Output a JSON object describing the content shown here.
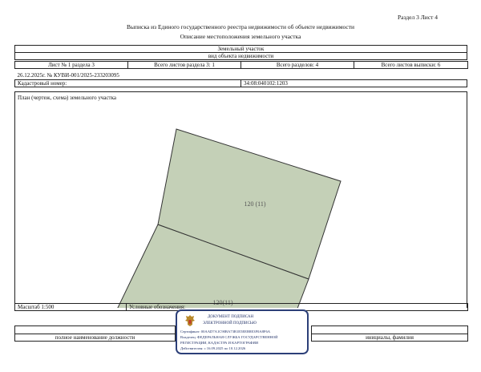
{
  "header": {
    "section_sheet": "Раздел 3   Лист 4",
    "title": "Выписка из Единого государственного реестра недвижимости об объекте недвижимости",
    "subtitle": "Описание местоположения земельного участка"
  },
  "object": {
    "name": "Земельный участок",
    "kind": "вид объекта недвижимости"
  },
  "sheet_info": {
    "sheet": "Лист № 1 раздела 3",
    "total_sheets_section": "Всего листов раздела 3: 1",
    "total_sections": "Всего разделов: 4",
    "total_sheets_extract": "Всего листов выписки: 6"
  },
  "reference": "26.12.2025г. № КУВИ-001/2025-233203095",
  "cadastral": {
    "label": "Кадастровый номер:",
    "value": "34:08:040102:1203"
  },
  "plan": {
    "label": "План (чертеж, схема) земельного участка",
    "parcel_upper": "120 (11)",
    "parcel_lower": "120(11)",
    "parcel_fill": "#c4d0b7",
    "border_color": "#333333"
  },
  "footer": {
    "scale": "Масштаб 1:500",
    "legend_label": "Условные обозначения:",
    "position_label": "полное наименование должности",
    "signature_label": "инициалы, фамилия"
  },
  "stamp": {
    "line1": "ДОКУМЕНТ ПОДПИСАН",
    "line2": "ЭЛЕКТРОННОЙ ПОДПИСЬЮ",
    "line3": "Сертификат: 00AAD7A1C90BA73B1E5EEB8E3F0A8F6A",
    "line4": "Владелец: ФЕДЕРАЛЬНАЯ СЛУЖБА ГОСУДАРСТВЕННОЙ",
    "line5": "РЕГИСТРАЦИИ, КАДАСТРА И КАРТОГРАФИИ",
    "line6": "Действителен: с 16.09.2025 по 10.12.2026",
    "color": "#2c3f78"
  }
}
